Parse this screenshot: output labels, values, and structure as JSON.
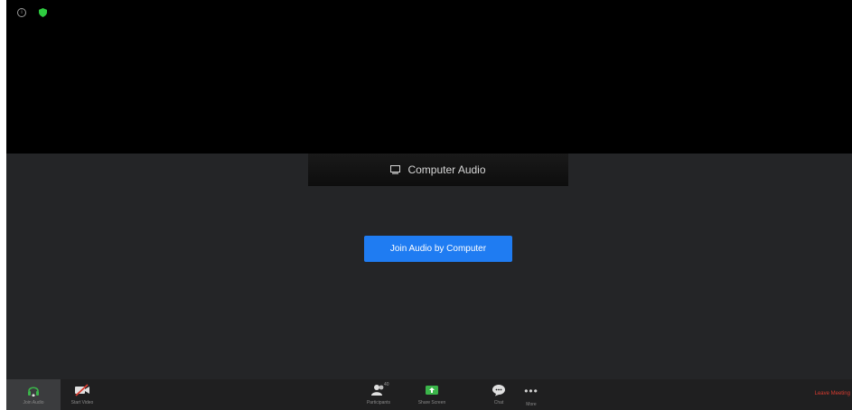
{
  "audio_panel": {
    "tab_label": "Computer Audio",
    "join_button_label": "Join Audio by Computer"
  },
  "toolbar": {
    "join_audio": "Join Audio",
    "start_video": "Start Video",
    "participants": "Participants",
    "participant_count": "40",
    "share_screen": "Share Screen",
    "chat": "Chat",
    "more": "More",
    "leave": "Leave Meeting"
  },
  "colors": {
    "join_button": "#1f7cf2",
    "share_screen_icon": "#3bb54a",
    "security_shield": "#2ecc40",
    "leave": "#d83b2f"
  }
}
